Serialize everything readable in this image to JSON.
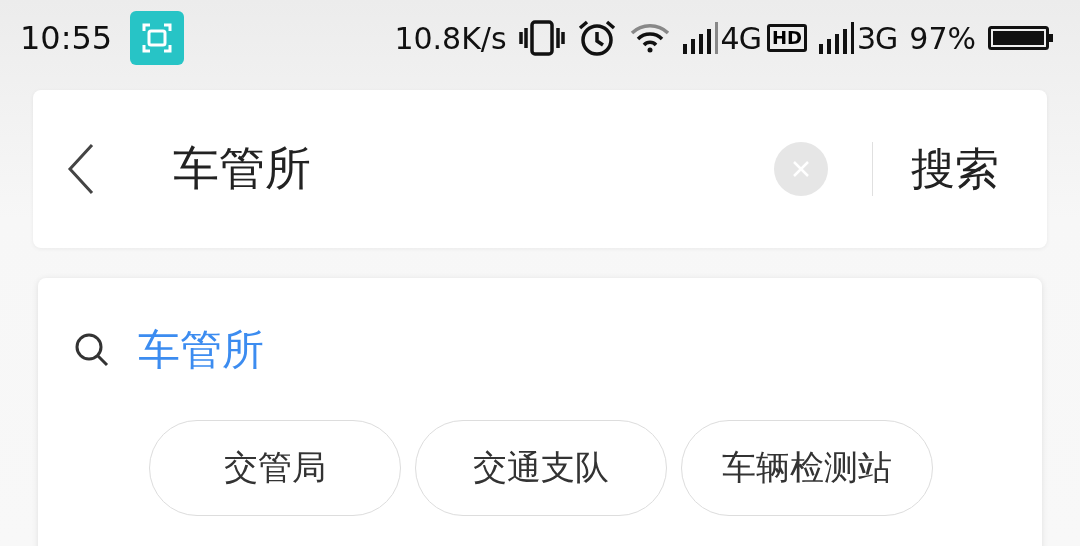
{
  "status_bar": {
    "time": "10:55",
    "speed": "10.8K/s",
    "network_1": "4G",
    "hd": "HD",
    "network_2": "3G",
    "battery": "97%"
  },
  "search_bar": {
    "value": "车管所",
    "button": "搜索"
  },
  "suggestion": {
    "query": "车管所",
    "chips": [
      "交管局",
      "交通支队",
      "车辆检测站"
    ]
  }
}
